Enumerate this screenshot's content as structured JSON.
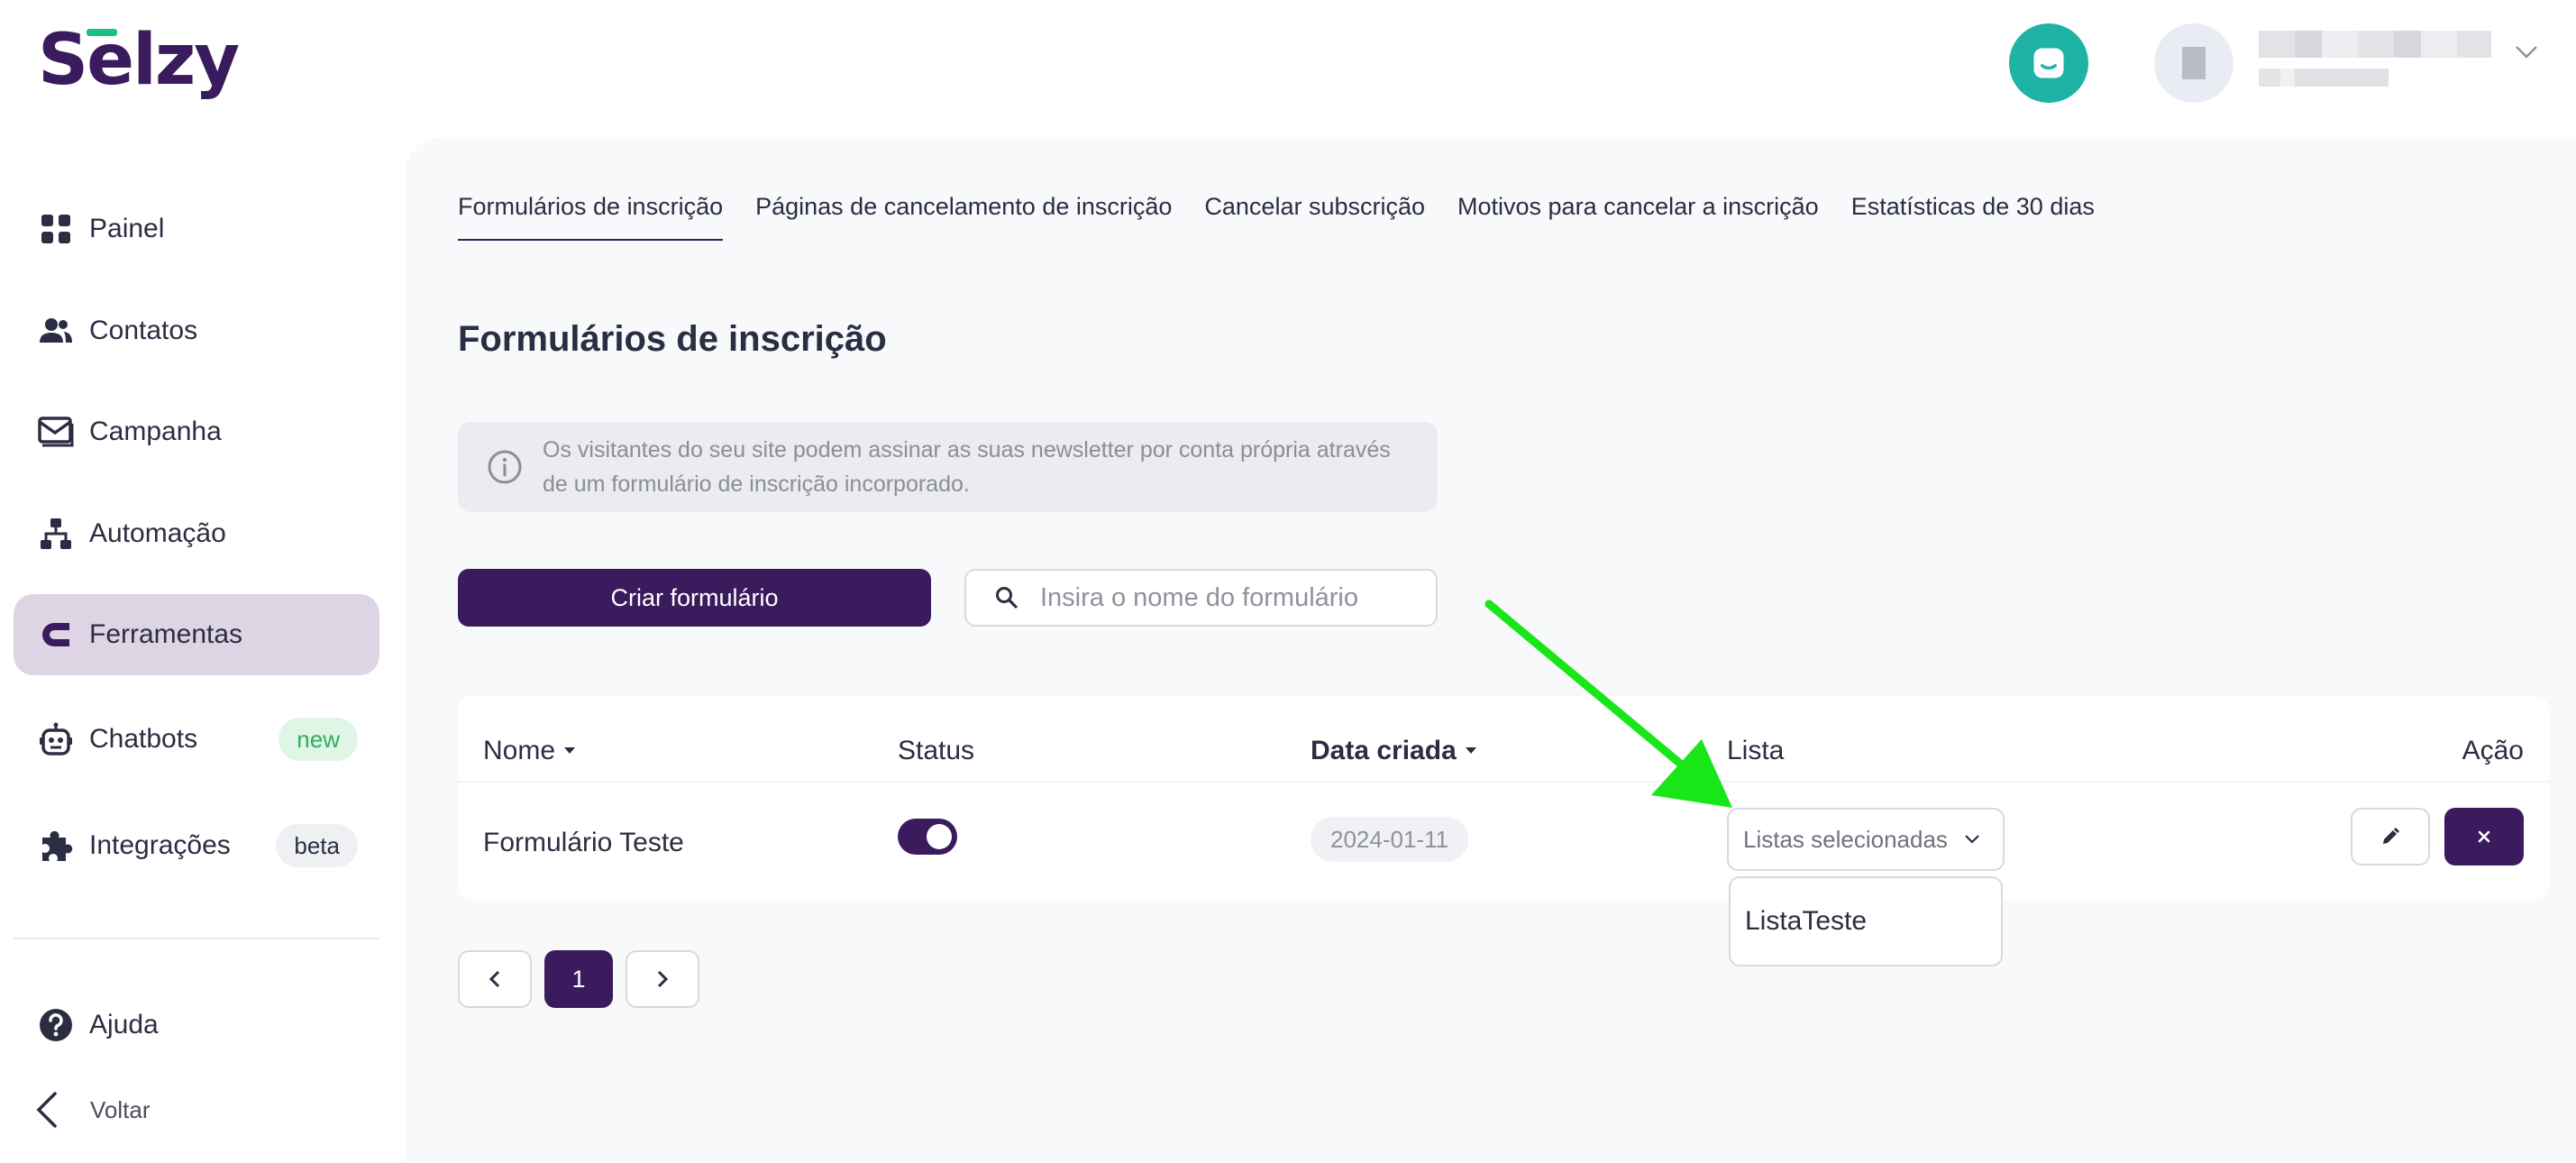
{
  "brand": {
    "logo_text": "Selzy",
    "accent_color": "#3a1b5e",
    "logo_bar_color": "#19c37d"
  },
  "header": {
    "chat_icon": "chat-bubble-icon",
    "avatar_icon": "user-avatar-icon"
  },
  "sidebar": {
    "items": [
      {
        "label": "Painel",
        "icon": "dashboard-grid-icon"
      },
      {
        "label": "Contatos",
        "icon": "contacts-icon"
      },
      {
        "label": "Campanha",
        "icon": "envelope-icon"
      },
      {
        "label": "Automação",
        "icon": "automation-tree-icon"
      },
      {
        "label": "Ferramentas",
        "icon": "magnet-icon",
        "active": true
      },
      {
        "label": "Chatbots",
        "icon": "robot-icon",
        "badge": "new"
      },
      {
        "label": "Integrações",
        "icon": "puzzle-icon",
        "badge": "beta"
      }
    ],
    "help": {
      "label": "Ajuda",
      "icon": "help-icon"
    },
    "back": {
      "label": "Voltar",
      "icon": "chevron-left-icon"
    }
  },
  "tabs": [
    {
      "label": "Formulários de inscrição",
      "active": true
    },
    {
      "label": "Páginas de cancelamento de inscrição"
    },
    {
      "label": "Cancelar subscrição"
    },
    {
      "label": "Motivos para cancelar a inscrição"
    },
    {
      "label": "Estatísticas de 30 dias"
    }
  ],
  "main": {
    "title": "Formulários de inscrição",
    "info_text": "Os visitantes do seu site podem assinar as suas newsletter por conta própria através de um formulário de inscrição incorporado.",
    "create_button": "Criar formulário",
    "search": {
      "placeholder": "Insira o nome do formulário",
      "value": ""
    }
  },
  "table": {
    "columns": [
      "Nome",
      "Status",
      "Data criada",
      "Lista",
      "Ação"
    ],
    "rows": [
      {
        "name": "Formulário Teste",
        "status_on": true,
        "created": "2024-01-11",
        "list_select": "Listas selecionadas",
        "list_options": [
          "ListaTeste"
        ]
      }
    ]
  },
  "pagination": {
    "current": "1"
  },
  "annotation": {
    "arrow_color": "#19e619"
  }
}
